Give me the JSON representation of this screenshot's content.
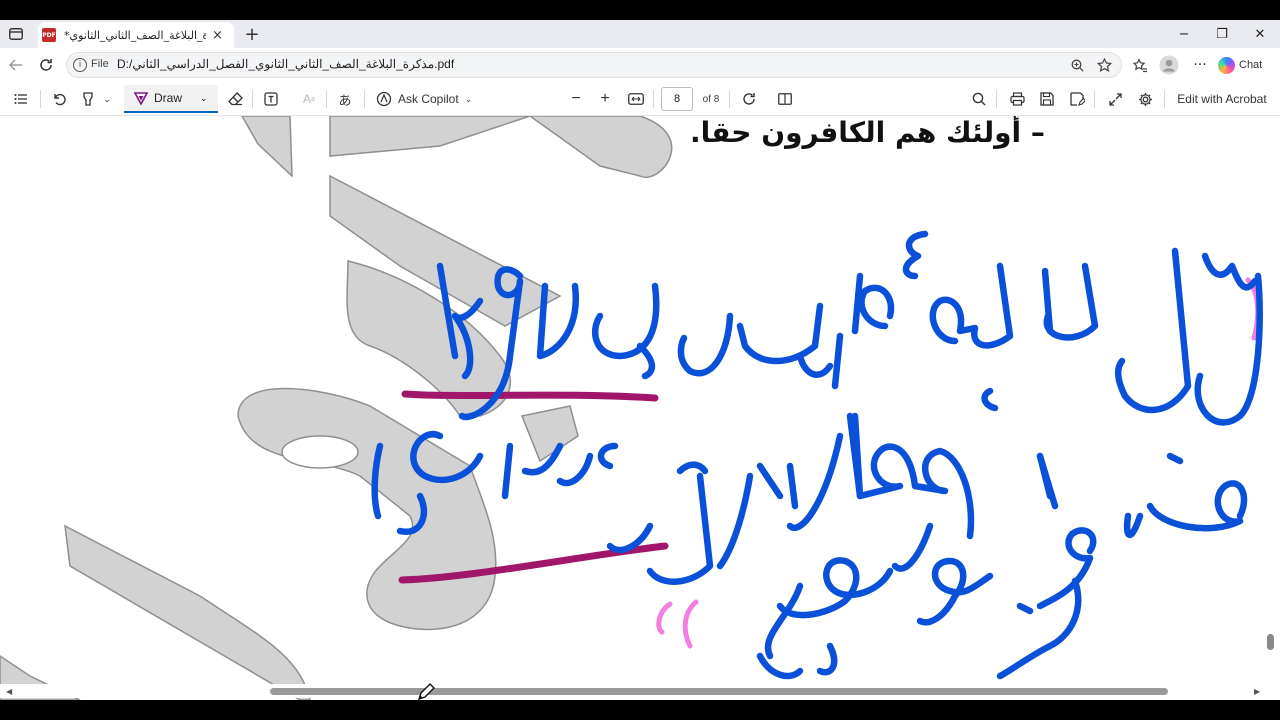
{
  "tab": {
    "title": "*مذكرة_البلاغة_الصف_الثاني_الثانوي",
    "close": "×",
    "new_tab": "+"
  },
  "window_controls": {
    "minimize": "−",
    "maximize": "❐",
    "close": "✕"
  },
  "address": {
    "scheme_label": "File",
    "url": "D:/مذكرة_البلاغة_الصف_الثاني_الثانوي_الفصل_الدراسي_الثاني.pdf"
  },
  "browser_tools": {
    "chat_label": "Chat",
    "more": "···"
  },
  "pdf_toolbar": {
    "draw_label": "Draw",
    "ask_copilot_label": "Ask Copilot",
    "page_number": "8",
    "page_total": "of 8",
    "edit_acrobat_label": "Edit with Acrobat"
  },
  "document": {
    "heading_line": "–  أولئك هم الكافرون حقا.",
    "handwriting_blue": [
      "قل للمؤمنين يغضوا",
      "من أبصارهم ويحفظوا",
      "فروجهم"
    ]
  },
  "colors": {
    "ink_blue": "#0b50d8",
    "ink_purple": "#a0166a",
    "ink_pink": "#f27ee0",
    "accent": "#0067c0",
    "watermark": "#cfcfcf"
  }
}
